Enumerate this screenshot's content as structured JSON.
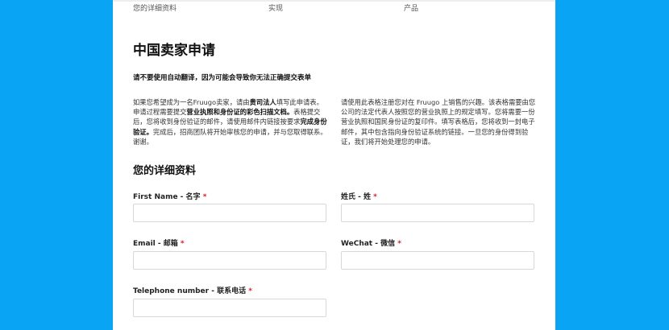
{
  "steps": [
    "您的详细资料",
    "实现",
    "产品"
  ],
  "title": "中国卖家申请",
  "warning": "请不要使用自动翻译，因为可能会导致你无法正确提交表单",
  "intro_left": [
    {
      "t": "如果您希望成为一名Fruugo卖家，请由",
      "b": false
    },
    {
      "t": "贵司法人",
      "b": true
    },
    {
      "t": "填写此申请表。申请过程需要提交",
      "b": false
    },
    {
      "t": "营业执照和身份证的彩色扫描文档。",
      "b": true
    },
    {
      "t": "表格提交后，您将收到身份验证的邮件，请使用邮件内链接按要求",
      "b": false
    },
    {
      "t": "完成身份验证。",
      "b": true
    },
    {
      "t": "完成后，招商团队将开始审核您的申请，并与您取得联系。谢谢。",
      "b": false
    }
  ],
  "intro_right": "请使用此表格注册您对在 Fruugo 上销售的兴趣。该表格需要由您公司的法定代表人按照您的营业执照上的规定填写。您将需要一份营业执照和国民身份证的复印件。填写表格后，您将收到一封电子邮件，其中包含指向身份验证系统的链接。一旦您的身份得到验证，我们将开始处理您的申请。",
  "section_title": "您的详细资料",
  "required_mark": "*",
  "fields": [
    {
      "label": "First Name - 名字",
      "value": ""
    },
    {
      "label": "姓氏 - 姓",
      "value": ""
    },
    {
      "label": "Email - 邮箱",
      "value": ""
    },
    {
      "label": "WeChat - 微信",
      "value": ""
    },
    {
      "label": "Telephone number - 联系电话",
      "value": ""
    }
  ],
  "colors": {
    "background": "#0aa4f5",
    "required": "#d0202c"
  }
}
